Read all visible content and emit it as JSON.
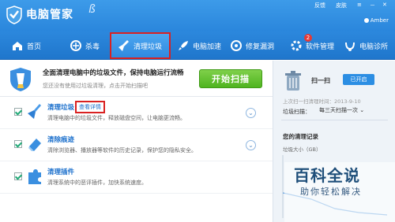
{
  "app": {
    "title": "电脑管家",
    "title_script": "ß",
    "window_controls": {
      "feedback": "反馈",
      "skin": "皮肤",
      "menu": "≡",
      "minimize": "－",
      "close": "✕"
    },
    "user": "Amber"
  },
  "nav": {
    "items": [
      {
        "label": "首页",
        "icon": "home-icon"
      },
      {
        "label": "杀毒",
        "icon": "antivirus-icon"
      },
      {
        "label": "清理垃圾",
        "icon": "broom-icon",
        "active": true
      },
      {
        "label": "电脑加速",
        "icon": "rocket-icon"
      },
      {
        "label": "修复漏洞",
        "icon": "patch-icon"
      },
      {
        "label": "软件管理",
        "icon": "software-icon",
        "badge": "2"
      },
      {
        "label": "电脑诊所",
        "icon": "clinic-icon"
      }
    ]
  },
  "banner": {
    "title": "全面清理电脑中的垃圾文件，保持电脑运行流畅",
    "subtitle": "您还没有使用过垃圾清理，点击开始扫描吧",
    "start_button": "开始扫描"
  },
  "rows": [
    {
      "title": "清理垃圾",
      "link": "查看详情",
      "desc": "清理电脑中的垃圾文件，释放磁盘空间，让电脑更流畅。",
      "checked": true
    },
    {
      "title": "清除痕迹",
      "desc": "清除浏览器、播放器等软件的历史记录，保护您的隐私安全。",
      "checked": true
    },
    {
      "title": "清理插件",
      "desc": "清理系统中的恶评插件，加快系统速度。",
      "checked": true
    }
  ],
  "side": {
    "weekly_label": "扫一扫",
    "toggle_label": "已开启",
    "last_clean": "上次扫一扫清理时间：2013-9-10",
    "freq_label": "垃圾扫描：",
    "freq_value": "每三天扫描一次",
    "records_title": "您的清理记录",
    "trash_size_label": "垃圾大小（GB）"
  },
  "watermark": {
    "title": "百科全说",
    "subtitle": "助你轻松解决"
  }
}
